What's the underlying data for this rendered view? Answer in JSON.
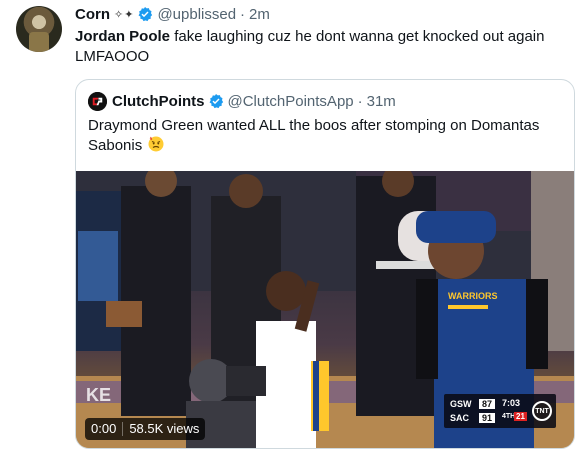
{
  "tweet": {
    "author_name": "Corn",
    "author_deco": "✧✦",
    "handle": "@upblissed",
    "separator": "·",
    "time": "2m",
    "text_bold": "Jordan Poole",
    "text_rest": " fake laughing cuz he dont wanna get knocked out again LMFAOOO"
  },
  "quote": {
    "author_name": "ClutchPoints",
    "handle": "@ClutchPointsApp",
    "separator": "·",
    "time": "31m",
    "text": "Draymond Green wanted ALL the boos after stomping on Domantas Sabonis",
    "media": {
      "time_label": "0:00",
      "views_label": "58.5K views",
      "jersey_text": "WARRIORS",
      "scorebug": {
        "team1": "GSW",
        "score1": "87",
        "team2": "SAC",
        "score2": "91",
        "clock": "7:03",
        "quarter": "4TH",
        "shot_clock": "21",
        "network": "TNT"
      }
    }
  },
  "colors": {
    "text": "#0f1419",
    "secondary": "#536471",
    "border": "#cfd9de",
    "verified": "#1d9bf0",
    "warriors_blue": "#1d428a",
    "warriors_gold": "#ffc72c"
  }
}
